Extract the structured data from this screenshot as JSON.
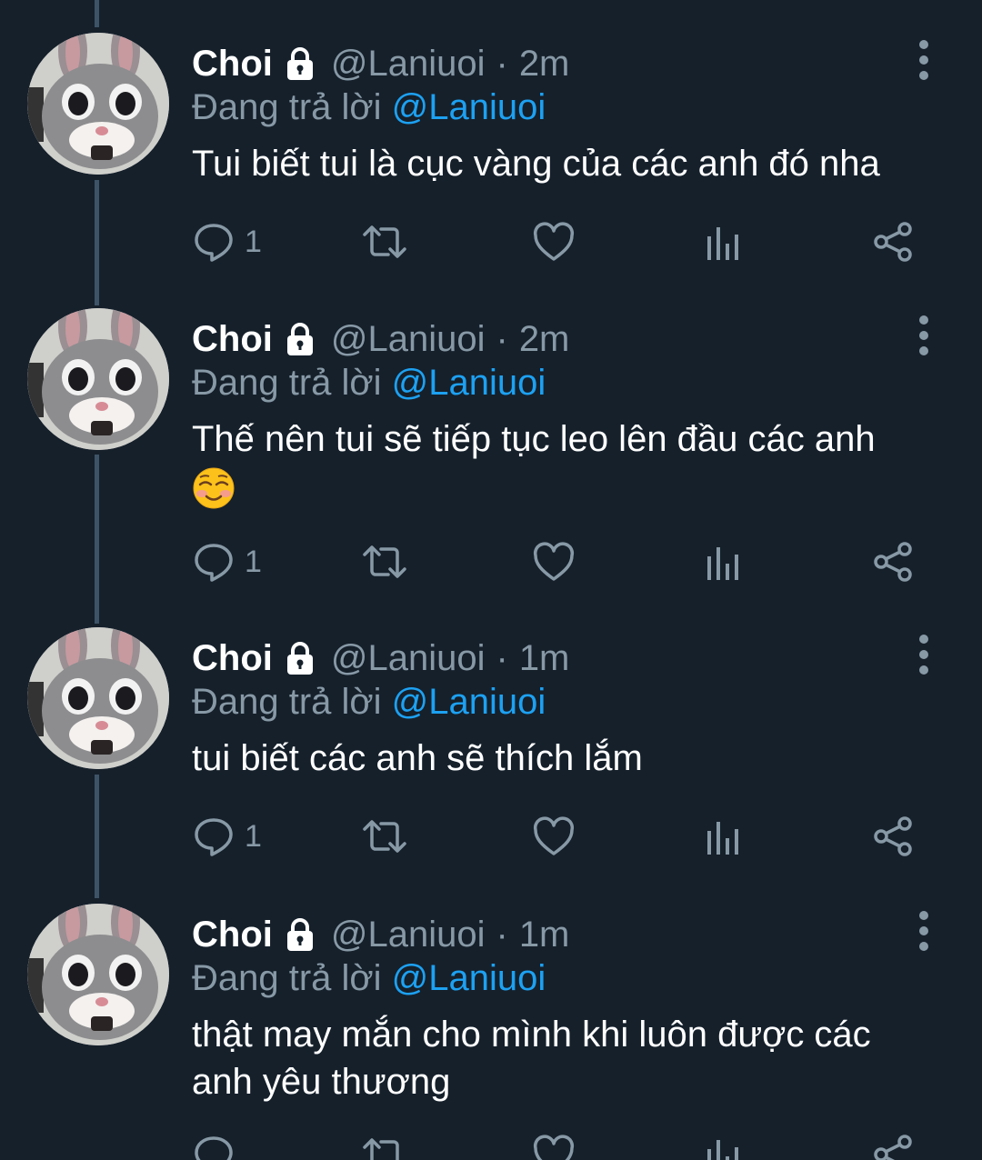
{
  "tweets": [
    {
      "name": "Choi",
      "handle": "@Laniuoi",
      "separator": "·",
      "time": "2m",
      "reply_prefix": "Đang trả lời",
      "reply_to": "@Laniuoi",
      "text": "Tui biết tui là cục vàng của các anh đó nha",
      "reply_count": "1"
    },
    {
      "name": "Choi",
      "handle": "@Laniuoi",
      "separator": "·",
      "time": "2m",
      "reply_prefix": "Đang trả lời",
      "reply_to": "@Laniuoi",
      "text": "Thế nên tui sẽ tiếp tục leo lên đầu các anh",
      "emoji": "smiling-face-icon",
      "reply_count": "1"
    },
    {
      "name": "Choi",
      "handle": "@Laniuoi",
      "separator": "·",
      "time": "1m",
      "reply_prefix": "Đang trả lời",
      "reply_to": "@Laniuoi",
      "text": "tui biết các anh sẽ thích lắm",
      "reply_count": "1"
    },
    {
      "name": "Choi",
      "handle": "@Laniuoi",
      "separator": "·",
      "time": "1m",
      "reply_prefix": "Đang trả lời",
      "reply_to": "@Laniuoi",
      "text": "thật may mắn cho mình khi luôn được các anh yêu thương",
      "reply_count": ""
    }
  ],
  "icons": {
    "reply": "reply-icon",
    "retweet": "retweet-icon",
    "like": "heart-icon",
    "views": "analytics-icon",
    "share": "share-icon",
    "lock": "lock-icon",
    "more": "more-vertical-icon"
  },
  "colors": {
    "background": "#15202b",
    "text": "#ffffff",
    "secondary": "#8899a6",
    "link": "#1da1f2",
    "thread_line": "#3d5466"
  }
}
